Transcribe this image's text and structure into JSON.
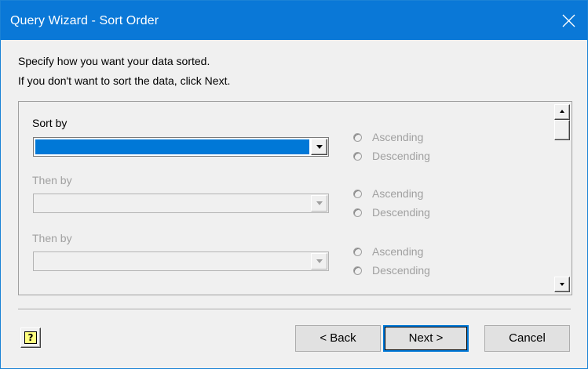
{
  "window": {
    "title": "Query Wizard - Sort Order"
  },
  "instructions": {
    "line1": "Specify how you want your data sorted.",
    "line2": "If you don't want to sort the data, click Next."
  },
  "sort_rows": [
    {
      "label": "Sort by",
      "enabled": true,
      "selected_value": "",
      "ascending": "Ascending",
      "descending": "Descending"
    },
    {
      "label": "Then by",
      "enabled": false,
      "selected_value": "",
      "ascending": "Ascending",
      "descending": "Descending"
    },
    {
      "label": "Then by",
      "enabled": false,
      "selected_value": "",
      "ascending": "Ascending",
      "descending": "Descending"
    }
  ],
  "buttons": {
    "help_glyph": "?",
    "back": "< Back",
    "next": "Next >",
    "cancel": "Cancel"
  },
  "icons": {
    "close": "close-icon",
    "help": "help-icon",
    "dropdown": "chevron-down-icon"
  },
  "colors": {
    "titlebar": "#0a78d7",
    "selection": "#0078d7",
    "disabled_text": "#a0a0a0"
  }
}
